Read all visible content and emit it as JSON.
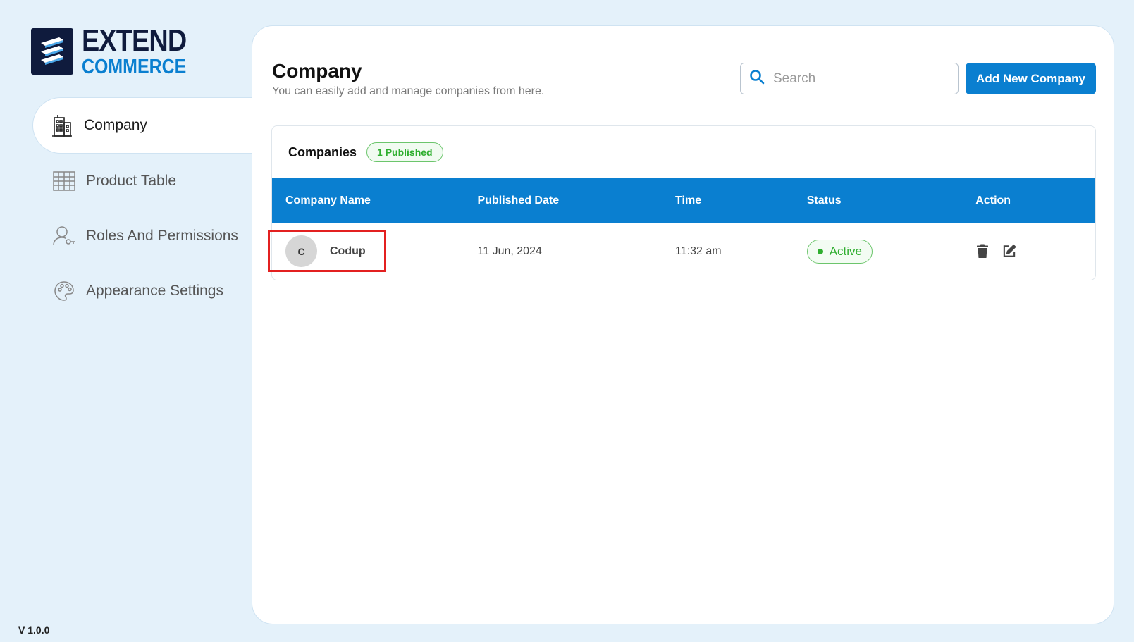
{
  "brand": {
    "line1": "EXTEND",
    "line2": "COMMERCE"
  },
  "sidebar": {
    "items": [
      {
        "label": "Company",
        "icon": "building-icon",
        "active": true
      },
      {
        "label": "Product Table",
        "icon": "table-grid-icon",
        "active": false
      },
      {
        "label": "Roles And Permissions",
        "icon": "user-key-icon",
        "active": false
      },
      {
        "label": "Appearance Settings",
        "icon": "palette-icon",
        "active": false
      }
    ],
    "version": "V 1.0.0"
  },
  "header": {
    "title": "Company",
    "subtitle": "You can easily add and manage companies from here.",
    "search_placeholder": "Search",
    "add_button": "Add New Company"
  },
  "companies": {
    "title": "Companies",
    "badge": "1 Published",
    "columns": [
      "Company Name",
      "Published Date",
      "Time",
      "Status",
      "Action"
    ],
    "rows": [
      {
        "avatar": "C",
        "name": "Codup",
        "published_date": "11 Jun, 2024",
        "time": "11:32 am",
        "status": "Active"
      }
    ]
  },
  "colors": {
    "accent": "#0a7fd0",
    "brand_dark": "#0f1b3d",
    "status_active": "#2fae2f",
    "highlight": "#e32020",
    "background": "#e4f1fa"
  }
}
